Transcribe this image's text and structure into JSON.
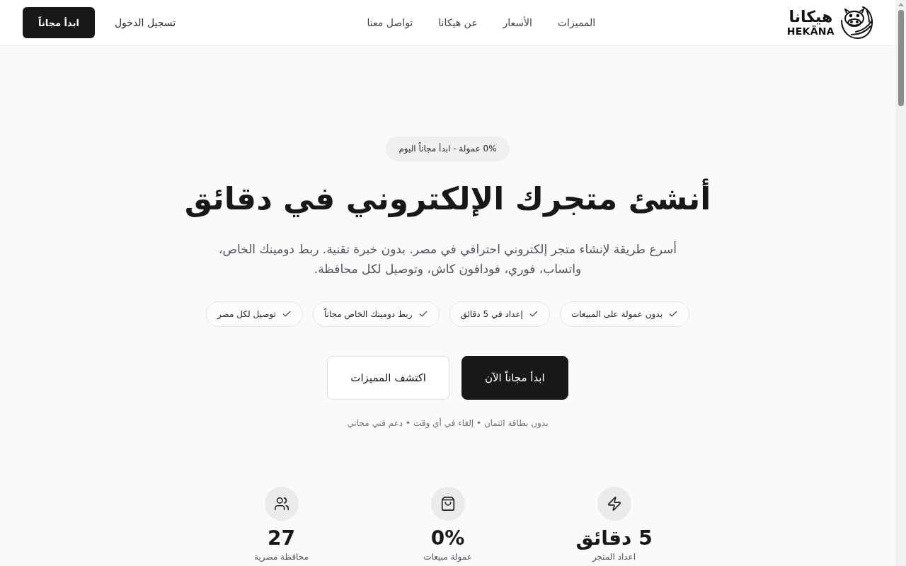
{
  "header": {
    "logo": {
      "arabic": "هيكانا",
      "latin": "HEKÄNA"
    },
    "nav": [
      {
        "label": "المميزات"
      },
      {
        "label": "الأسعار"
      },
      {
        "label": "عن هيكانا"
      },
      {
        "label": "تواصل معنا"
      }
    ],
    "login": "تسجيل الدخول",
    "cta": "ابدأ مجاناً"
  },
  "hero": {
    "badge": "0% عمولة - ابدأ مجاناً اليوم",
    "title": "أنشئ متجرك الإلكتروني في دقائق",
    "subtitle": "أسرع طريقة لإنشاء متجر إلكتروني احترافي في مصر. بدون خبرة تقنية. ربط دومينك الخاص، واتساب، فوري، فودافون كاش، وتوصيل لكل محافظة.",
    "features": [
      "بدون عمولة على المبيعات",
      "إعداد في 5 دقائق",
      "ربط دومينك الخاص مجاناً",
      "توصيل لكل مصر"
    ],
    "buttons": [
      {
        "label": "ابدأ مجاناً الآن",
        "kind": "primary"
      },
      {
        "label": "اكتشف المميزات",
        "kind": "outline"
      }
    ],
    "note": "بدون بطاقة ائتمان • إلغاء في أي وقت • دعم فني مجاني"
  },
  "stats": [
    {
      "value": "5 دقائق",
      "label": "اعداد المتجر"
    },
    {
      "value": "0%",
      "label": "عمولة مبيعات"
    },
    {
      "value": "27",
      "label": "محافظة مصرية"
    }
  ]
}
